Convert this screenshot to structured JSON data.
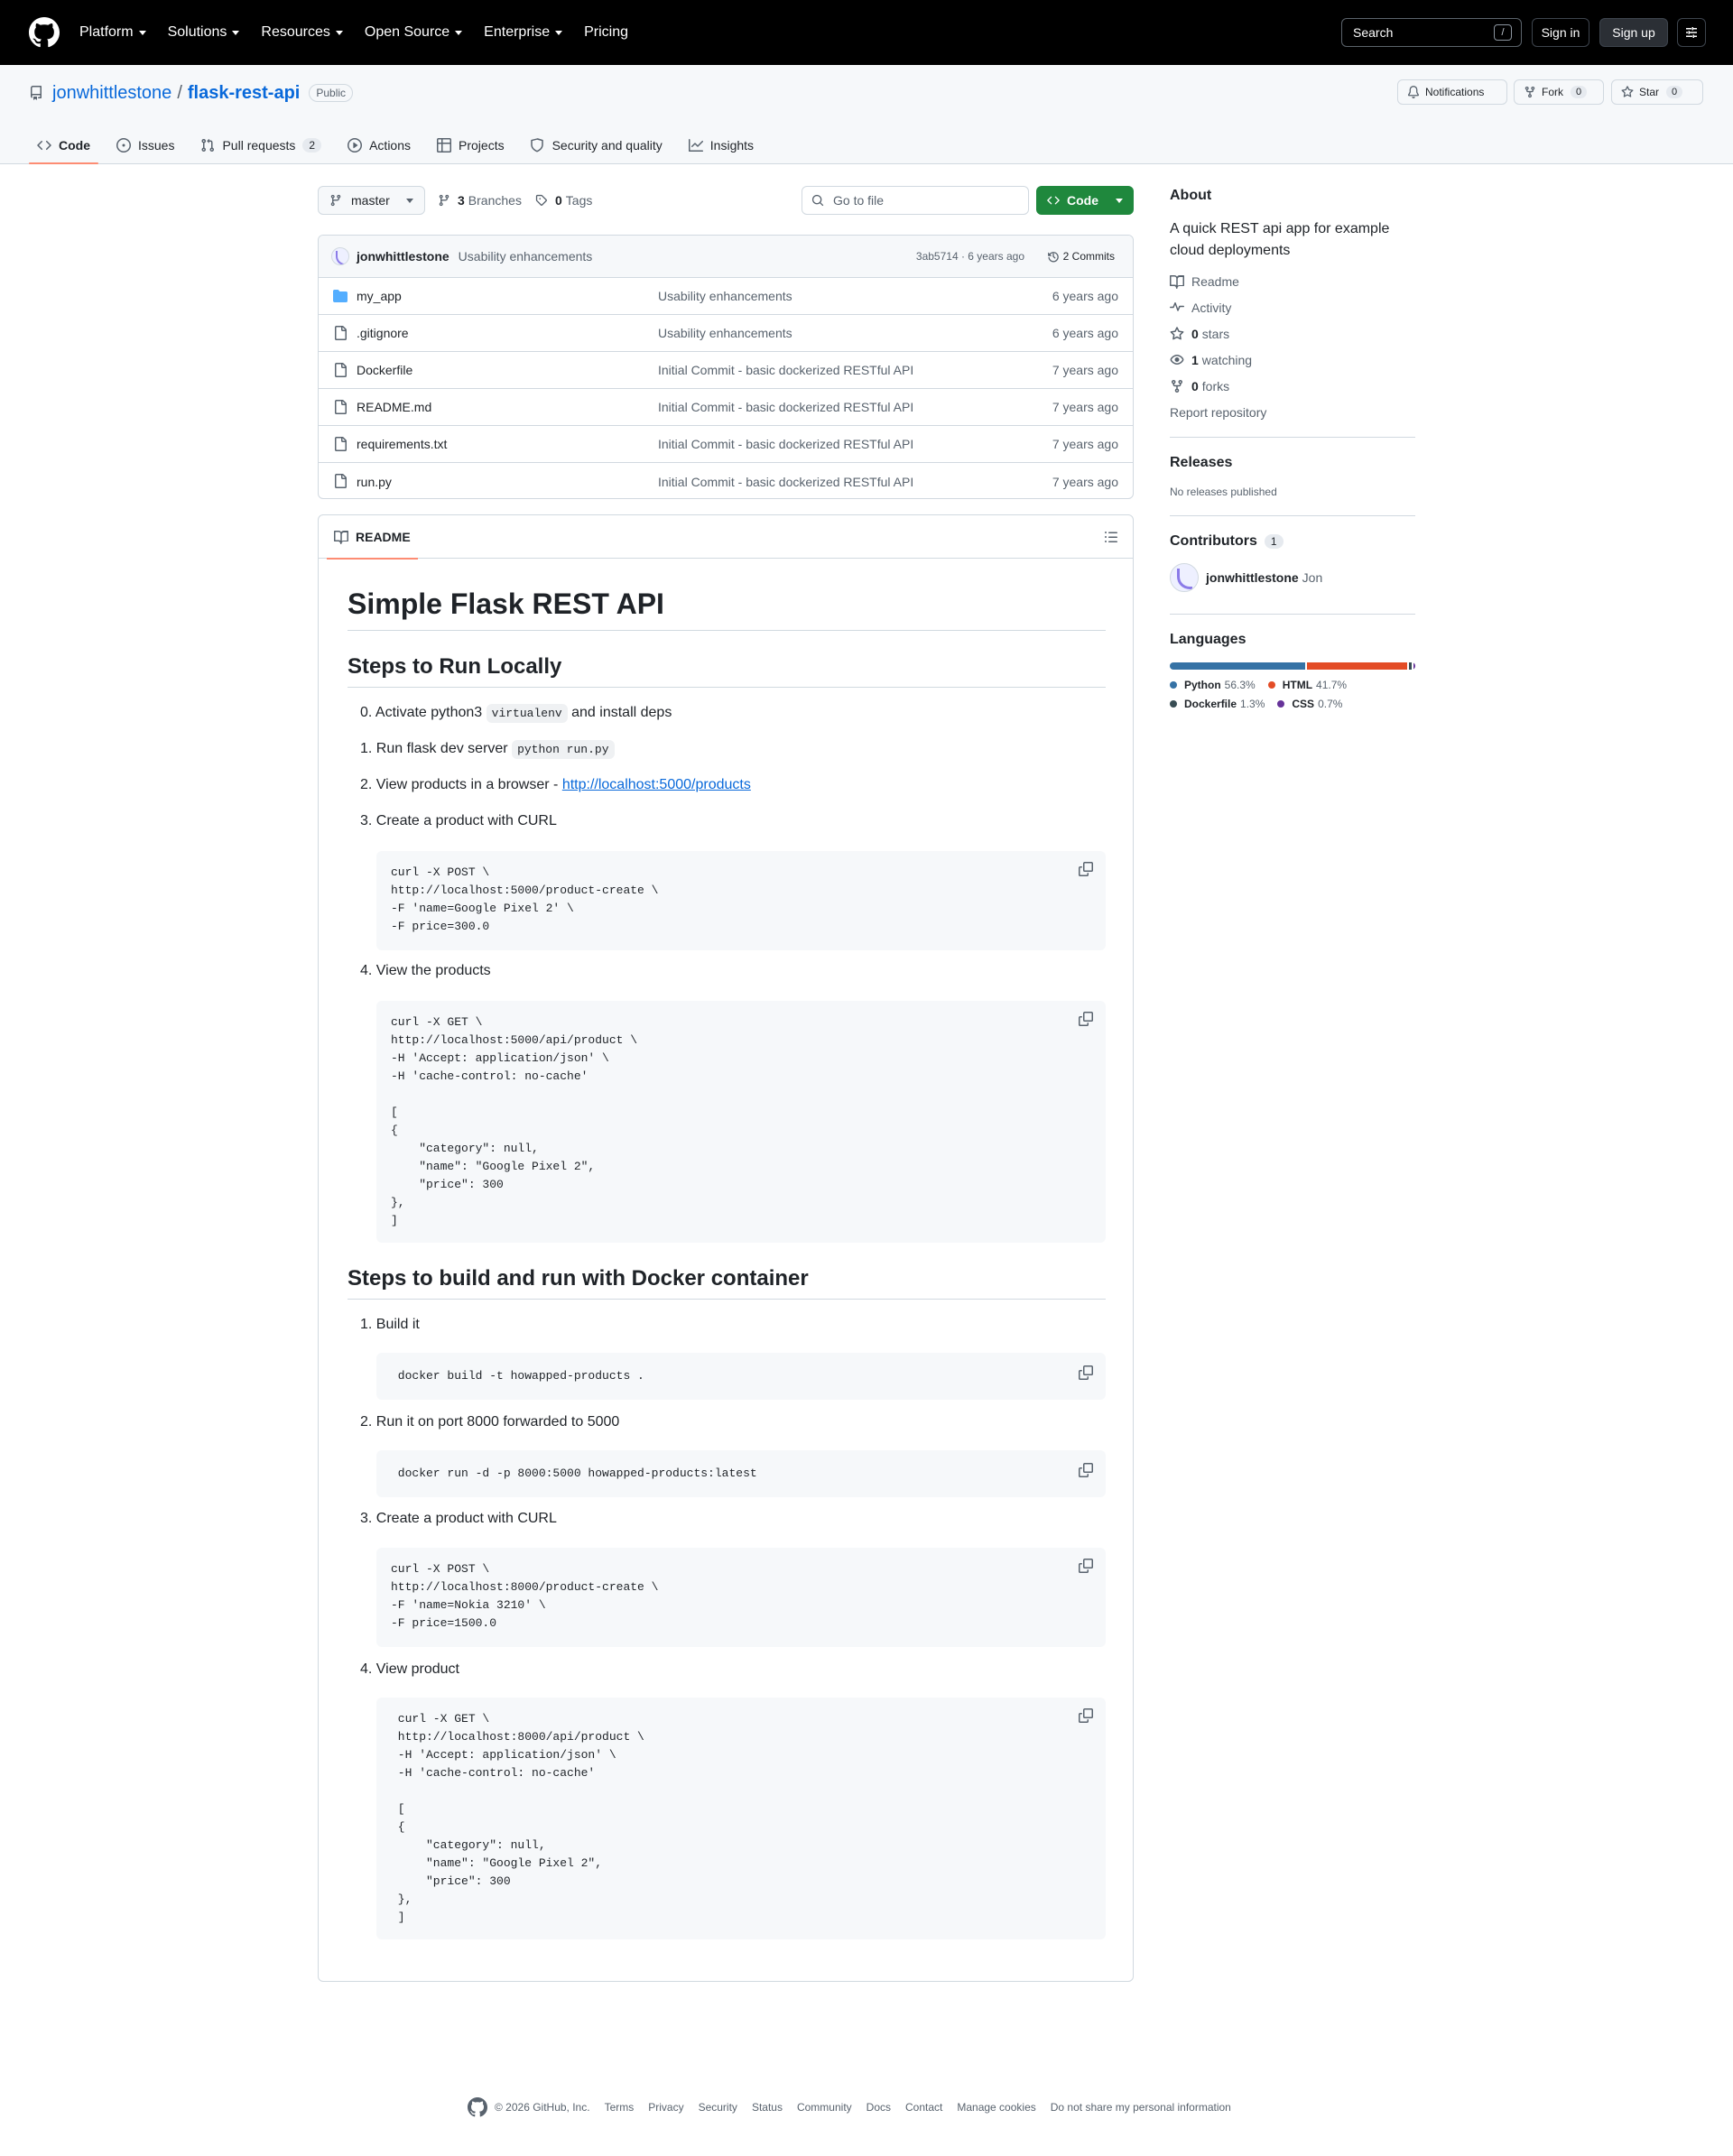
{
  "header": {
    "nav": [
      {
        "label": "Platform",
        "dropdown": true
      },
      {
        "label": "Solutions",
        "dropdown": true
      },
      {
        "label": "Resources",
        "dropdown": true
      },
      {
        "label": "Open Source",
        "dropdown": true
      },
      {
        "label": "Enterprise",
        "dropdown": true
      },
      {
        "label": "Pricing",
        "dropdown": false
      }
    ],
    "search_label": "Search",
    "search_shortcut": "/",
    "signin": "Sign in",
    "signup": "Sign up"
  },
  "repo": {
    "owner": "jonwhittlestone",
    "separator": "/",
    "name": "flask-rest-api",
    "visibility": "Public",
    "notifications": "Notifications",
    "fork_label": "Fork",
    "fork_count": "0",
    "star_label": "Star",
    "star_count": "0"
  },
  "tabs": [
    {
      "label": "Code",
      "icon": "code-icon",
      "active": true,
      "count": null
    },
    {
      "label": "Issues",
      "icon": "issue-icon",
      "active": false,
      "count": null
    },
    {
      "label": "Pull requests",
      "icon": "pull-request-icon",
      "active": false,
      "count": "2"
    },
    {
      "label": "Actions",
      "icon": "play-icon",
      "active": false,
      "count": null
    },
    {
      "label": "Projects",
      "icon": "table-icon",
      "active": false,
      "count": null
    },
    {
      "label": "Security and quality",
      "icon": "shield-icon",
      "active": false,
      "count": null
    },
    {
      "label": "Insights",
      "icon": "graph-icon",
      "active": false,
      "count": null
    }
  ],
  "branchbar": {
    "branch": "master",
    "branches_count": "3",
    "branches_label": "Branches",
    "tags_count": "0",
    "tags_label": "Tags",
    "goto_placeholder": "Go to file",
    "code_button": "Code"
  },
  "commit": {
    "author": "jonwhittlestone",
    "message": "Usability enhancements",
    "meta": "3ab5714 · 6 years ago",
    "commits": "2 Commits"
  },
  "files": [
    {
      "name": "my_app",
      "type": "folder",
      "message": "Usability enhancements",
      "age": "6 years ago"
    },
    {
      "name": ".gitignore",
      "type": "file",
      "message": "Usability enhancements",
      "age": "6 years ago"
    },
    {
      "name": "Dockerfile",
      "type": "file",
      "message": "Initial Commit - basic dockerized RESTful API",
      "age": "7 years ago"
    },
    {
      "name": "README.md",
      "type": "file",
      "message": "Initial Commit - basic dockerized RESTful API",
      "age": "7 years ago"
    },
    {
      "name": "requirements.txt",
      "type": "file",
      "message": "Initial Commit - basic dockerized RESTful API",
      "age": "7 years ago"
    },
    {
      "name": "run.py",
      "type": "file",
      "message": "Initial Commit - basic dockerized RESTful API",
      "age": "7 years ago"
    }
  ],
  "readme": {
    "tab_label": "README",
    "title": "Simple Flask REST API",
    "section1": "Steps to Run Locally",
    "s1_item0_pre": "0. Activate python3",
    "s1_item0_code": "virtualenv",
    "s1_item0_post": "and install deps",
    "s1_item1_pre": "1. Run flask dev server",
    "s1_item1_code": "python run.py",
    "s1_item2_pre": "2. View products in a browser -",
    "s1_item2_link": "http://localhost:5000/products",
    "s1_item3": "3. Create a product with CURL",
    "code1": "curl -X POST \\\nhttp://localhost:5000/product-create \\\n-F 'name=Google Pixel 2' \\\n-F price=300.0",
    "s1_item4": "4. View the products",
    "code2": "curl -X GET \\\nhttp://localhost:5000/api/product \\\n-H 'Accept: application/json' \\\n-H 'cache-control: no-cache'\n\n[\n{\n    \"category\": null,\n    \"name\": \"Google Pixel 2\",\n    \"price\": 300\n},\n]",
    "section2": "Steps to build and run with Docker container",
    "s2_item1": "1. Build it",
    "code3": " docker build -t howapped-products .",
    "s2_item2": "2. Run it on port 8000 forwarded to 5000",
    "code4": " docker run -d -p 8000:5000 howapped-products:latest",
    "s2_item3": "3. Create a product with CURL",
    "code5": "curl -X POST \\\nhttp://localhost:8000/product-create \\\n-F 'name=Nokia 3210' \\\n-F price=1500.0",
    "s2_item4": "4. View product",
    "code6": " curl -X GET \\\n http://localhost:8000/api/product \\\n -H 'Accept: application/json' \\\n -H 'cache-control: no-cache'\n\n [\n {\n     \"category\": null,\n     \"name\": \"Google Pixel 2\",\n     \"price\": 300\n },\n ]"
  },
  "sidebar": {
    "about_title": "About",
    "description": "A quick REST api app for example cloud deployments",
    "readme": "Readme",
    "activity": "Activity",
    "stars_count": "0",
    "stars_label": "stars",
    "watching_count": "1",
    "watching_label": "watching",
    "forks_count": "0",
    "forks_label": "forks",
    "report": "Report repository",
    "releases_title": "Releases",
    "releases_text": "No releases published",
    "contributors_title": "Contributors",
    "contributors_count": "1",
    "contributor_login": "jonwhittlestone",
    "contributor_name": "Jon",
    "languages_title": "Languages",
    "languages": [
      {
        "name": "Python",
        "percent": 56.3,
        "label": "56.3%",
        "color": "#3572A5"
      },
      {
        "name": "HTML",
        "percent": 41.7,
        "label": "41.7%",
        "color": "#e34c26"
      },
      {
        "name": "Dockerfile",
        "percent": 1.3,
        "label": "1.3%",
        "color": "#384d54"
      },
      {
        "name": "CSS",
        "percent": 0.7,
        "label": "0.7%",
        "color": "#663399"
      }
    ]
  },
  "footer": {
    "copyright": "© 2026 GitHub, Inc.",
    "links": [
      "Terms",
      "Privacy",
      "Security",
      "Status",
      "Community",
      "Docs",
      "Contact",
      "Manage cookies",
      "Do not share my personal information"
    ]
  }
}
